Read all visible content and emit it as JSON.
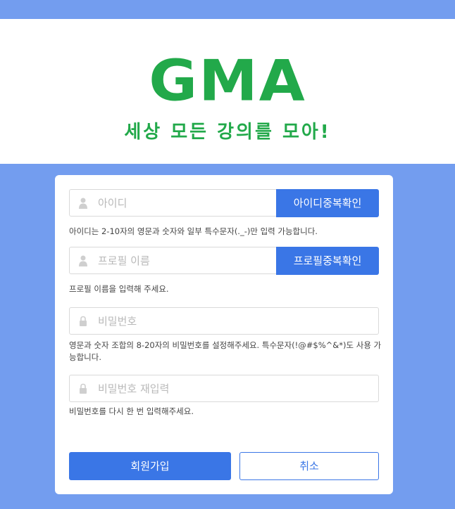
{
  "header": {
    "logo": "GMA",
    "tagline": "세상 모든 강의를 모아!"
  },
  "colors": {
    "brand_green": "#22a94a",
    "accent_blue": "#3a76e6",
    "page_bg": "#739def"
  },
  "form": {
    "id": {
      "placeholder": "아이디",
      "check_button": "아이디중복확인",
      "help": "아이디는 2-10자의 영문과 숫자와 일부 특수문자(._-)만 입력 가능합니다.",
      "icon": "user-icon"
    },
    "profile": {
      "placeholder": "프로필 이름",
      "check_button": "프로필중복확인",
      "help": "프로필 이름을 입력해 주세요.",
      "icon": "user-icon"
    },
    "password": {
      "placeholder": "비밀번호",
      "help": "영문과 숫자 조합의 8-20자의 비밀번호를 설정해주세요. 특수문자(!@#$%^&*)도 사용 가능합니다.",
      "icon": "lock-icon"
    },
    "password_confirm": {
      "placeholder": "비밀번호 재입력",
      "help": "비밀번호를 다시 한 번 입력해주세요.",
      "icon": "lock-icon"
    },
    "signup_button": "회원가입",
    "cancel_button": "취소"
  }
}
